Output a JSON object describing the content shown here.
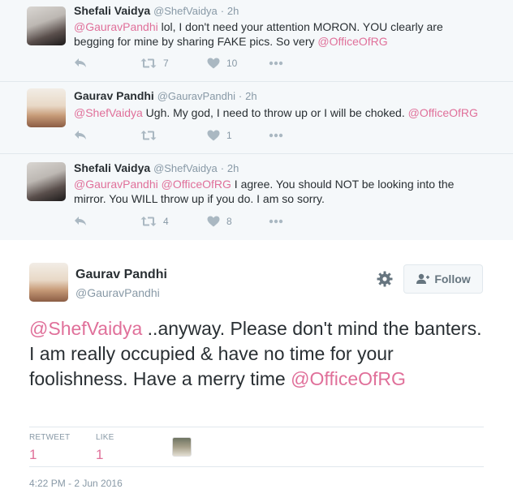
{
  "conversation": [
    {
      "name": "Shefali Vaidya",
      "handle": "@ShefVaidya",
      "dot": "·",
      "time": "2h",
      "text_parts": [
        {
          "t": "@GauravPandhi",
          "m": true
        },
        {
          "t": " lol, I don't need your attention MORON. YOU clearly are begging for mine by sharing FAKE pics. So very ",
          "m": false
        },
        {
          "t": "@OfficeOfRG",
          "m": true
        }
      ],
      "retweets": "7",
      "likes": "10"
    },
    {
      "name": "Gaurav Pandhi",
      "handle": "@GauravPandhi",
      "dot": "·",
      "time": "2h",
      "text_parts": [
        {
          "t": "@ShefVaidya",
          "m": true
        },
        {
          "t": " Ugh. My god, I need to throw up or I will be choked. ",
          "m": false
        },
        {
          "t": "@OfficeOfRG",
          "m": true
        }
      ],
      "retweets": "",
      "likes": "1"
    },
    {
      "name": "Shefali Vaidya",
      "handle": "@ShefVaidya",
      "dot": "·",
      "time": "2h",
      "text_parts": [
        {
          "t": "@GauravPandhi",
          "m": true
        },
        {
          "t": " ",
          "m": false
        },
        {
          "t": "@OfficeOfRG",
          "m": true
        },
        {
          "t": " I agree. You should NOT be looking into the mirror. You WILL throw up if you do. I am so sorry.",
          "m": false
        }
      ],
      "retweets": "4",
      "likes": "8"
    }
  ],
  "main_tweet": {
    "name": "Gaurav Pandhi",
    "handle": "@GauravPandhi",
    "follow_label": "Follow",
    "text_parts": [
      {
        "t": "@ShefVaidya",
        "m": true
      },
      {
        "t": " ..anyway. Please don't mind the banters. I am really occupied & have no time for your foolishness. Have a merry time ",
        "m": false
      },
      {
        "t": "@OfficeOfRG",
        "m": true
      }
    ],
    "retweet_label": "RETWEET",
    "retweet_count": "1",
    "like_label": "LIKE",
    "like_count": "1",
    "timestamp": "4:22 PM - 2 Jun 2016"
  },
  "colors": {
    "mention": "#e0709a",
    "conversation_bg": "#f5f8fa",
    "muted": "#8899a6"
  },
  "icons": [
    "reply-icon",
    "retweet-icon",
    "heart-icon",
    "more-icon",
    "gear-icon",
    "follow-person-icon"
  ]
}
